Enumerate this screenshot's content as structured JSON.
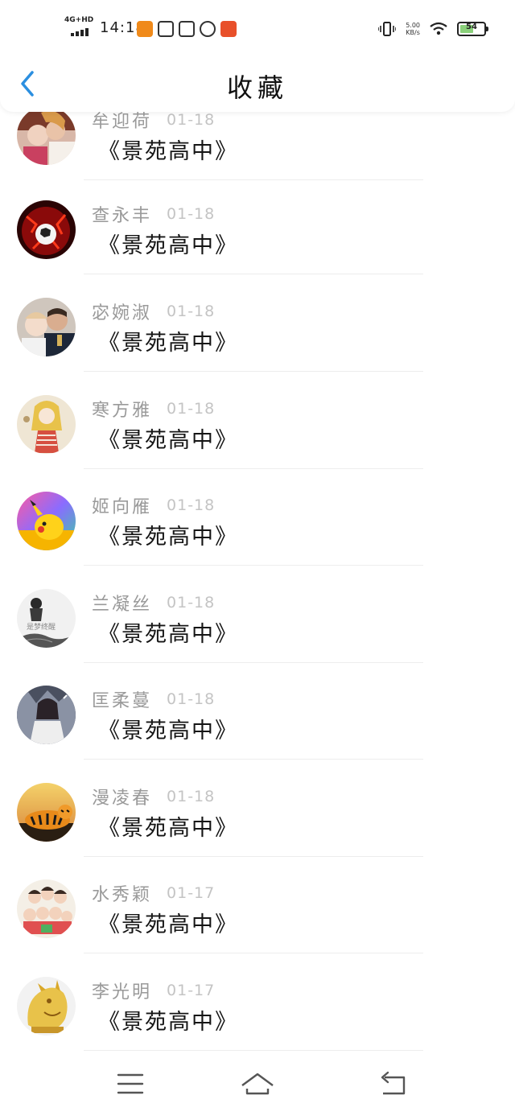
{
  "status_bar": {
    "network": "4G+HD",
    "time": "14:18",
    "speed_value": "5.00",
    "speed_unit": "KB/s",
    "battery": "54"
  },
  "header": {
    "title": "收藏",
    "back_icon": "chevron-left-icon"
  },
  "favorites": [
    {
      "name": "牟迎荷",
      "date": "01-18",
      "title": "《景苑高中》"
    },
    {
      "name": "查永丰",
      "date": "01-18",
      "title": "《景苑高中》"
    },
    {
      "name": "宓婉淑",
      "date": "01-18",
      "title": "《景苑高中》"
    },
    {
      "name": "寒方雅",
      "date": "01-18",
      "title": "《景苑高中》"
    },
    {
      "name": "姬向雁",
      "date": "01-18",
      "title": "《景苑高中》"
    },
    {
      "name": "兰凝丝",
      "date": "01-18",
      "title": "《景苑高中》"
    },
    {
      "name": "匡柔蔓",
      "date": "01-18",
      "title": "《景苑高中》"
    },
    {
      "name": "漫凌春",
      "date": "01-18",
      "title": "《景苑高中》"
    },
    {
      "name": "水秀颖",
      "date": "01-17",
      "title": "《景苑高中》"
    },
    {
      "name": "李光明",
      "date": "01-17",
      "title": "《景苑高中》"
    }
  ],
  "avatar_art": {
    "avatar-4_caption": "是梦终醒"
  },
  "nav": {
    "menu_icon": "menu-icon",
    "home_icon": "home-icon",
    "back_icon": "back-arrow-icon"
  },
  "colors": {
    "accent": "#2b8fe0",
    "title_text": "#151515",
    "name_text": "#9a9a9a",
    "date_text": "#c4c4c4"
  }
}
